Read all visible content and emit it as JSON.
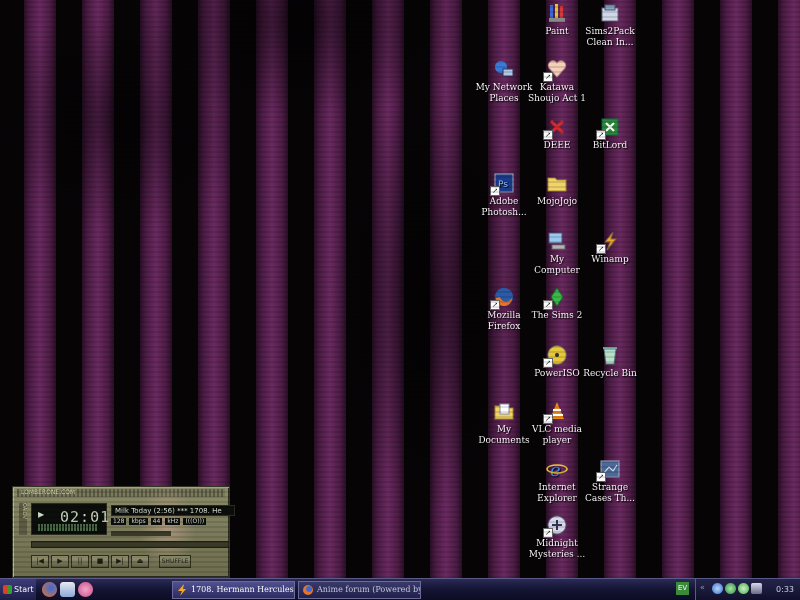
{
  "desktop_icons": {
    "paint": "Paint",
    "sims2pack": "Sims2Pack\nClean In...",
    "network_places": "My Network\nPlaces",
    "katawa": "Katawa\nShoujo Act 1",
    "deee": "DEEE",
    "bitlord": "BitLord",
    "photoshop": "Adobe\nPhotosh...",
    "mojojojo": "MojoJojo",
    "my_computer": "My\nComputer",
    "winamp": "Winamp",
    "firefox": "Mozilla\nFirefox",
    "sims2": "The Sims 2",
    "poweriso": "PowerISO",
    "recycle_bin": "Recycle Bin",
    "my_documents": "My\nDocuments",
    "vlc": "VLC media\nplayer",
    "ie": "Internet\nExplorer",
    "strange_cases": "Strange\nCases Th...",
    "midnight": "Midnight\nMysteries ..."
  },
  "winamp": {
    "title": "LOMBERONE.COM",
    "time": "02:01",
    "song": "Milk Today (2:56) *** 1708. He",
    "bitrate": "128",
    "kbps": "kbps",
    "khz_value": "44",
    "khz": "kHz",
    "mode": "(((O)))",
    "shuffle": "SHUFFLE"
  },
  "taskbar": {
    "start": "Start",
    "task1": "1708. Hermann Hercules - ...",
    "task2": "Anime forum (Powered by ...",
    "lang": "EV",
    "clock": "0:33"
  },
  "colors": {
    "stripe_purple": "#6a2a60",
    "taskbar": "#141434",
    "winamp_skin": "#7a7a5e"
  }
}
